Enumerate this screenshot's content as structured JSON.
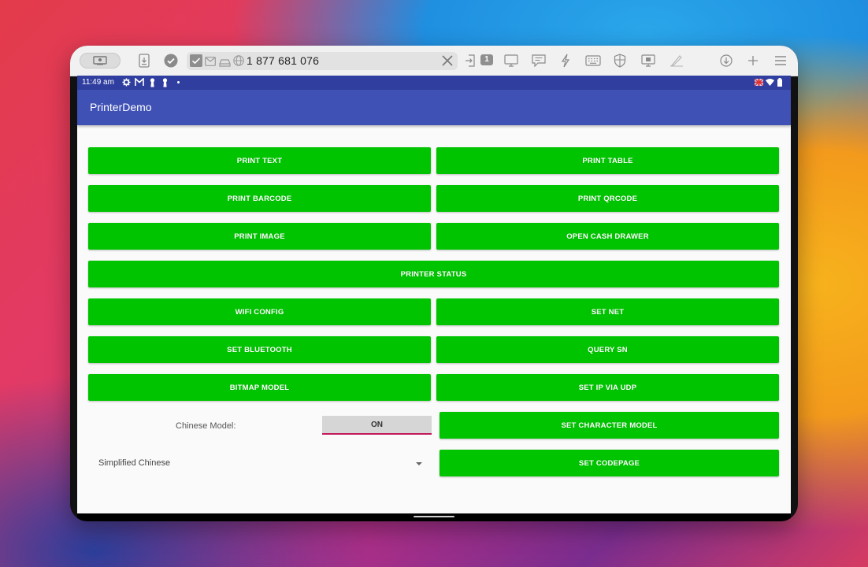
{
  "browser": {
    "url": "1 877 681 076",
    "tab_count": "1",
    "icons": [
      "screen-share-icon",
      "download-doc-icon",
      "check-circle-icon",
      "checkbox-icon",
      "mail-icon",
      "drive-icon",
      "globe-icon",
      "clear-icon",
      "enter-icon",
      "monitor-icon",
      "chat-icon",
      "lightning-icon",
      "keyboard-icon",
      "shield-icon",
      "remote-desktop-icon",
      "pen-icon",
      "download-icon",
      "add-icon",
      "menu-icon"
    ]
  },
  "statusbar": {
    "time": "11:49 am"
  },
  "app": {
    "title": "PrinterDemo",
    "buttons": {
      "print_text": "PRINT TEXT",
      "print_table": "PRINT TABLE",
      "print_barcode": "PRINT BARCODE",
      "print_qrcode": "PRINT QRCODE",
      "print_image": "PRINT IMAGE",
      "open_cash_drawer": "OPEN CASH DRAWER",
      "printer_status": "PRINTER STATUS",
      "wifi_config": "WIFI CONFIG",
      "set_net": "SET NET",
      "set_bluetooth": "SET BLUETOOTH",
      "query_sn": "QUERY SN",
      "bitmap_model": "BITMAP MODEL",
      "set_ip_via_udp": "SET IP VIA UDP",
      "set_character_model": "SET CHARACTER MODEL",
      "set_codepage": "SET CODEPAGE"
    },
    "chinese_model_label": "Chinese Model:",
    "chinese_model_toggle": "ON",
    "codepage_select": "Simplified Chinese",
    "colors": {
      "button": "#00c400",
      "appbar": "#3f51b5",
      "statusbar": "#303f9f",
      "toggle_underline": "#c2185b"
    }
  }
}
